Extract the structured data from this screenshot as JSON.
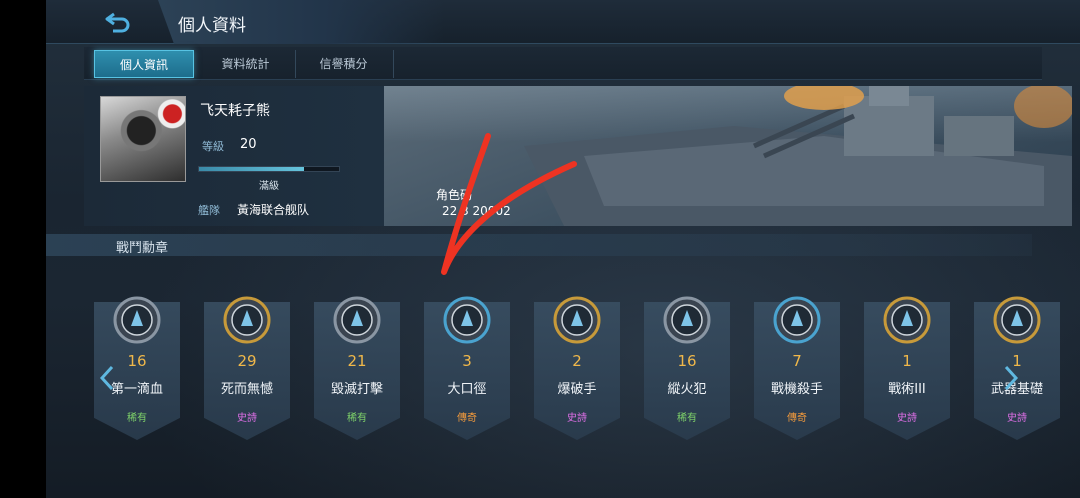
{
  "header": {
    "title": "個人資料",
    "back_icon": "back-arrow-icon"
  },
  "tabs": [
    {
      "label": "個人資訊",
      "active": true
    },
    {
      "label": "資料統計",
      "active": false
    },
    {
      "label": "信譽積分",
      "active": false
    }
  ],
  "profile": {
    "name": "飞天耗子熊",
    "level_label": "等級",
    "level": "20",
    "exp_text": "滿級",
    "exp_fraction": 0.75,
    "fleet_label": "艦隊",
    "fleet": "黃海联合舰队",
    "role_label": "角色码",
    "role_id": "22  3    20002"
  },
  "medals_section": {
    "title": "戰鬥勳章"
  },
  "medals": [
    {
      "count": "16",
      "name": "第一滴血",
      "rarity": "稀有",
      "rarity_class": "rare",
      "color": "#8a96a3"
    },
    {
      "count": "29",
      "name": "死而無憾",
      "rarity": "史詩",
      "rarity_class": "epic",
      "color": "#c79a3a"
    },
    {
      "count": "21",
      "name": "毀滅打擊",
      "rarity": "稀有",
      "rarity_class": "rare",
      "color": "#8a96a3"
    },
    {
      "count": "3",
      "name": "大口徑",
      "rarity": "傳奇",
      "rarity_class": "legend",
      "color": "#4aa3cf"
    },
    {
      "count": "2",
      "name": "爆破手",
      "rarity": "史詩",
      "rarity_class": "epic",
      "color": "#c79a3a"
    },
    {
      "count": "16",
      "name": "縱火犯",
      "rarity": "稀有",
      "rarity_class": "rare",
      "color": "#8a96a3"
    },
    {
      "count": "7",
      "name": "戰機殺手",
      "rarity": "傳奇",
      "rarity_class": "legend",
      "color": "#4aa3cf"
    },
    {
      "count": "1",
      "name": "戰術III",
      "rarity": "史詩",
      "rarity_class": "epic",
      "color": "#c79a3a"
    },
    {
      "count": "1",
      "name": "武器基礎",
      "rarity": "史詩",
      "rarity_class": "epic",
      "color": "#c79a3a"
    }
  ],
  "colors": {
    "accent": "#2f8fae",
    "gold": "#f0b84a",
    "annotation": "#ee3322"
  }
}
